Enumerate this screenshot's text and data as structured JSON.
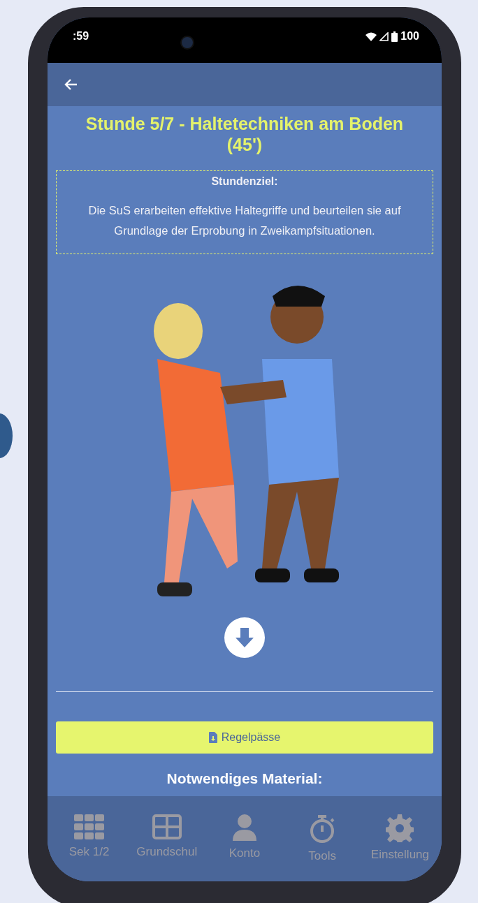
{
  "status_bar": {
    "time": ":59",
    "battery": "100"
  },
  "lesson": {
    "title": "Stunde 5/7 - Haltetechniken am Boden (45')",
    "goal_heading": "Stundenziel:",
    "goal_text": "Die SuS erarbeiten effektive Haltegriffe und beurteilen sie auf Grundlage der Erprobung in Zweikampfsituationen.",
    "button": "Regelpässe",
    "material_heading": "Notwendiges Material:"
  },
  "nav": [
    {
      "label": "Sek 1/2",
      "selected": false
    },
    {
      "label": "Grundschul",
      "selected": false
    },
    {
      "label": "Konto",
      "selected": false
    },
    {
      "label": "Tools",
      "selected": false
    },
    {
      "label": "Einstellung",
      "selected": false
    }
  ]
}
